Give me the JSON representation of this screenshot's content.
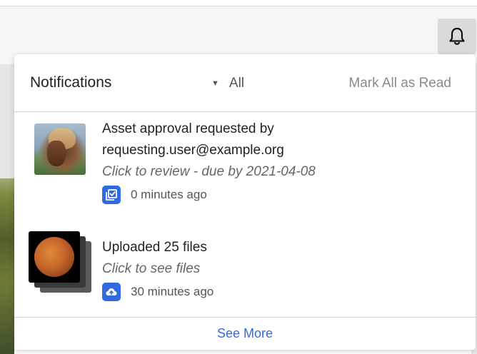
{
  "header": {
    "bell_icon": "bell-icon"
  },
  "panel": {
    "title": "Notifications",
    "filter_label": "All",
    "mark_all_label": "Mark All as Read",
    "see_more_label": "See More"
  },
  "notifications": [
    {
      "line1": "Asset approval requested by",
      "line2": "requesting.user@example.org",
      "subtitle": "Click to review - due by 2021-04-08",
      "time": "0 minutes ago",
      "icon": "approval-icon"
    },
    {
      "line1": "Uploaded 25 files",
      "subtitle": "Click to see files",
      "time": "30 minutes ago",
      "icon": "cloud-upload-icon"
    }
  ],
  "colors": {
    "accent": "#2f6ae0",
    "badge": "#2f6ae0"
  }
}
